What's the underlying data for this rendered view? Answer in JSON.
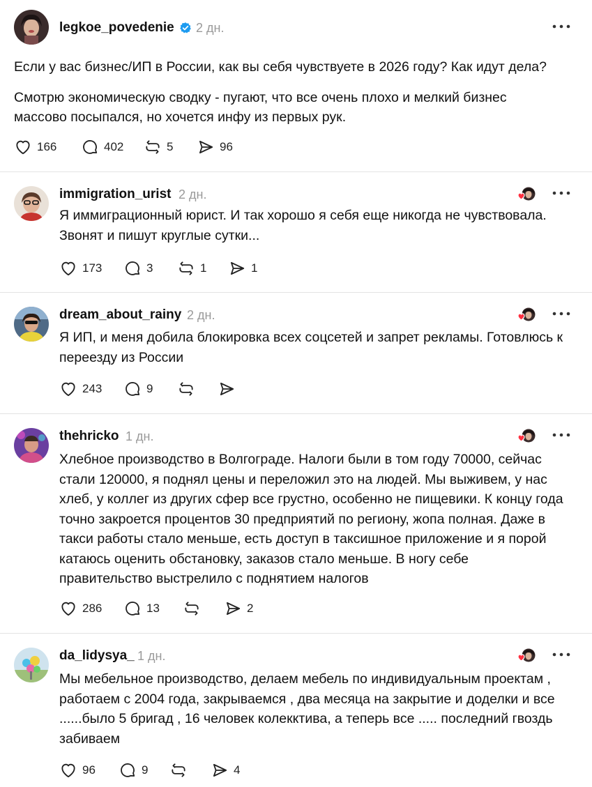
{
  "main_post": {
    "username": "legkoe_povedenie",
    "time": "2 дн.",
    "paragraph1": "Если у вас бизнес/ИП в России, как вы себя чувствуете в 2026 году? Как идут дела?",
    "paragraph2": "Смотрю экономическую сводку - пугают, что все очень плохо и мелкий бизнес массово посыпался, но хочется инфу из первых рук.",
    "likes": "166",
    "replies": "402",
    "reposts": "5",
    "shares": "96"
  },
  "replies": [
    {
      "username": "immigration_urist",
      "time": "2 дн.",
      "text": "Я иммиграционный юрист. И так хорошо я себя еще никогда не чувствовала. Звонят и пишут круглые сутки...",
      "likes": "173",
      "replies": "3",
      "reposts": "1",
      "shares": "1"
    },
    {
      "username": "dream_about_rainy",
      "time": "2 дн.",
      "text": "Я ИП, и меня добила блокировка всех соцсетей и запрет рекламы. Готовлюсь к переезду из России",
      "likes": "243",
      "replies": "9",
      "reposts": "",
      "shares": ""
    },
    {
      "username": "thehricko",
      "time": "1 дн.",
      "text": "Хлебное производство в Волгограде. Налоги были в том году 70000, сейчас стали 120000, я поднял цены и переложил это на людей. Мы выживем, у нас хлеб, у коллег из других сфер все грустно, особенно не пищевики. К концу года точно закроется процентов 30 предприятий по региону, жопа полная. Даже в такси работы стало меньше, есть доступ в таксишное приложение и я порой катаюсь оценить обстановку, заказов стало меньше. В ногу себе правительство выстрелило с поднятием налогов",
      "likes": "286",
      "replies": "13",
      "reposts": "",
      "shares": "2"
    },
    {
      "username": "da_lidysya_",
      "time": "1 дн.",
      "text": "Мы мебельное производство, делаем мебель по индивидуальным проектам , работаем с 2004 года, закрываемся , два месяца на закрытие и доделки и все ......было 5 бригад , 16 человек колекктива, а теперь все ..... последний гвоздь забиваем",
      "likes": "96",
      "replies": "9",
      "reposts": "",
      "shares": "4"
    }
  ],
  "colors": {
    "verified": "#1d9bf0",
    "like_heart": "#ff3040",
    "muted": "#9a9a9a",
    "divider": "#e3e3e3"
  },
  "icons": [
    "heart-icon",
    "comment-icon",
    "repost-icon",
    "share-icon",
    "more-icon",
    "verified-icon",
    "liked-by-author-icon"
  ]
}
